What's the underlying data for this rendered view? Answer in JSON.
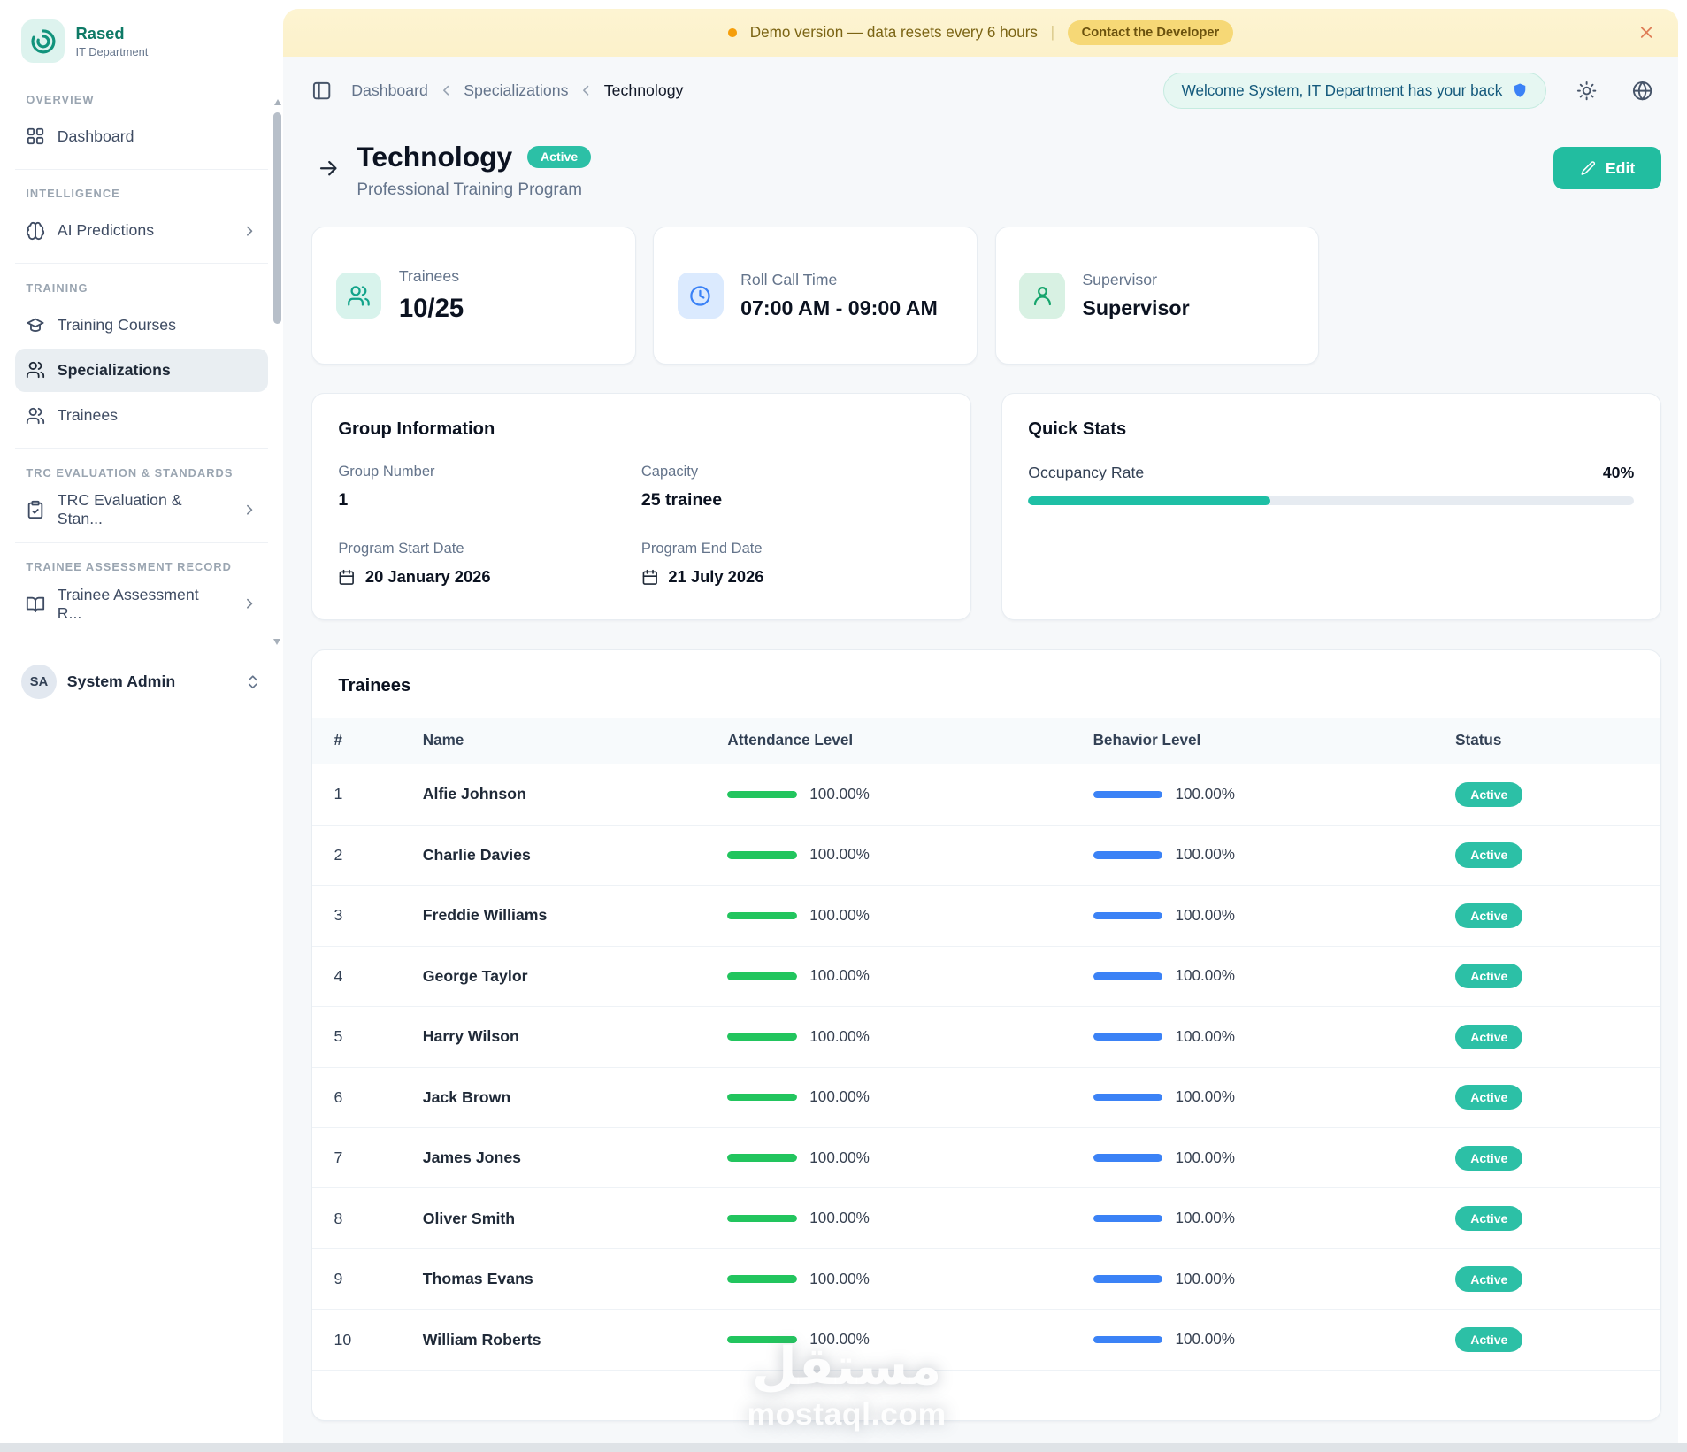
{
  "app": {
    "name": "Rased",
    "department": "IT Department"
  },
  "banner": {
    "text": "Demo version — data resets every 6 hours",
    "separator": "|",
    "button_label": "Contact the Developer"
  },
  "header": {
    "breadcrumbs": [
      "Dashboard",
      "Specializations",
      "Technology"
    ],
    "welcome_text": "Welcome System, IT Department has your back"
  },
  "sidebar": {
    "sections": [
      {
        "label": "OVERVIEW",
        "items": [
          {
            "label": "Dashboard",
            "icon": "dashboard-grid-icon"
          }
        ]
      },
      {
        "label": "INTELLIGENCE",
        "items": [
          {
            "label": "AI Predictions",
            "icon": "brain-icon",
            "chevron": true
          }
        ]
      },
      {
        "label": "TRAINING",
        "items": [
          {
            "label": "Training Courses",
            "icon": "graduation-cap-icon"
          },
          {
            "label": "Specializations",
            "icon": "users-icon",
            "active": true
          },
          {
            "label": "Trainees",
            "icon": "users-icon"
          }
        ]
      },
      {
        "label": "TRC EVALUATION & STANDARDS",
        "items": [
          {
            "label": "TRC Evaluation & Stan...",
            "icon": "clipboard-check-icon",
            "chevron": true
          }
        ]
      },
      {
        "label": "TRAINEE ASSESSMENT RECORD",
        "items": [
          {
            "label": "Trainee Assessment R...",
            "icon": "book-open-icon",
            "chevron": true
          }
        ]
      }
    ],
    "user": {
      "initials": "SA",
      "name": "System Admin"
    }
  },
  "page": {
    "title": "Technology",
    "status_badge": "Active",
    "subtitle": "Professional Training Program",
    "edit_button": "Edit"
  },
  "stat_cards": [
    {
      "label": "Trainees",
      "value": "10/25",
      "icon": "trainees-users-icon"
    },
    {
      "label": "Roll Call Time",
      "value": "07:00 AM - 09:00 AM",
      "icon": "clock-icon"
    },
    {
      "label": "Supervisor",
      "value": "Supervisor",
      "icon": "supervisor-user-icon"
    }
  ],
  "group_information": {
    "title": "Group Information",
    "group_number_label": "Group Number",
    "group_number_value": "1",
    "capacity_label": "Capacity",
    "capacity_value": "25 trainee",
    "start_date_label": "Program Start Date",
    "start_date_value": "20 January 2026",
    "end_date_label": "Program End Date",
    "end_date_value": "21 July 2026"
  },
  "quick_stats": {
    "title": "Quick Stats",
    "occupancy_label": "Occupancy Rate",
    "occupancy_value": "40%",
    "occupancy_percent": 40
  },
  "trainees_table": {
    "title": "Trainees",
    "columns": [
      "#",
      "Name",
      "Attendance Level",
      "Behavior Level",
      "Status"
    ],
    "rows": [
      {
        "num": "1",
        "name": "Alfie Johnson",
        "attendance": "100.00%",
        "behavior": "100.00%",
        "status": "Active"
      },
      {
        "num": "2",
        "name": "Charlie Davies",
        "attendance": "100.00%",
        "behavior": "100.00%",
        "status": "Active"
      },
      {
        "num": "3",
        "name": "Freddie Williams",
        "attendance": "100.00%",
        "behavior": "100.00%",
        "status": "Active"
      },
      {
        "num": "4",
        "name": "George Taylor",
        "attendance": "100.00%",
        "behavior": "100.00%",
        "status": "Active"
      },
      {
        "num": "5",
        "name": "Harry Wilson",
        "attendance": "100.00%",
        "behavior": "100.00%",
        "status": "Active"
      },
      {
        "num": "6",
        "name": "Jack Brown",
        "attendance": "100.00%",
        "behavior": "100.00%",
        "status": "Active"
      },
      {
        "num": "7",
        "name": "James Jones",
        "attendance": "100.00%",
        "behavior": "100.00%",
        "status": "Active"
      },
      {
        "num": "8",
        "name": "Oliver Smith",
        "attendance": "100.00%",
        "behavior": "100.00%",
        "status": "Active"
      },
      {
        "num": "9",
        "name": "Thomas Evans",
        "attendance": "100.00%",
        "behavior": "100.00%",
        "status": "Active"
      },
      {
        "num": "10",
        "name": "William Roberts",
        "attendance": "100.00%",
        "behavior": "100.00%",
        "status": "Active"
      }
    ]
  },
  "watermark": {
    "line1": "مستقل",
    "line2": "mostaql.com"
  },
  "colors": {
    "primary_teal": "#22bda0",
    "attendance_green": "#22c55e",
    "behavior_blue": "#3b82f6",
    "banner_yellow": "#fcf2cd",
    "shield_blue": "#3b82f6"
  },
  "icons": {
    "banner_dot": "orange-dot",
    "banner_close": "x-icon",
    "sidebar_toggle": "panel-left-icon",
    "theme": "sun-icon",
    "language": "globe-icon",
    "welcome_shield": "shield-icon",
    "back": "arrow-right-icon",
    "edit": "pencil-icon",
    "dates": "calendar-icon"
  }
}
